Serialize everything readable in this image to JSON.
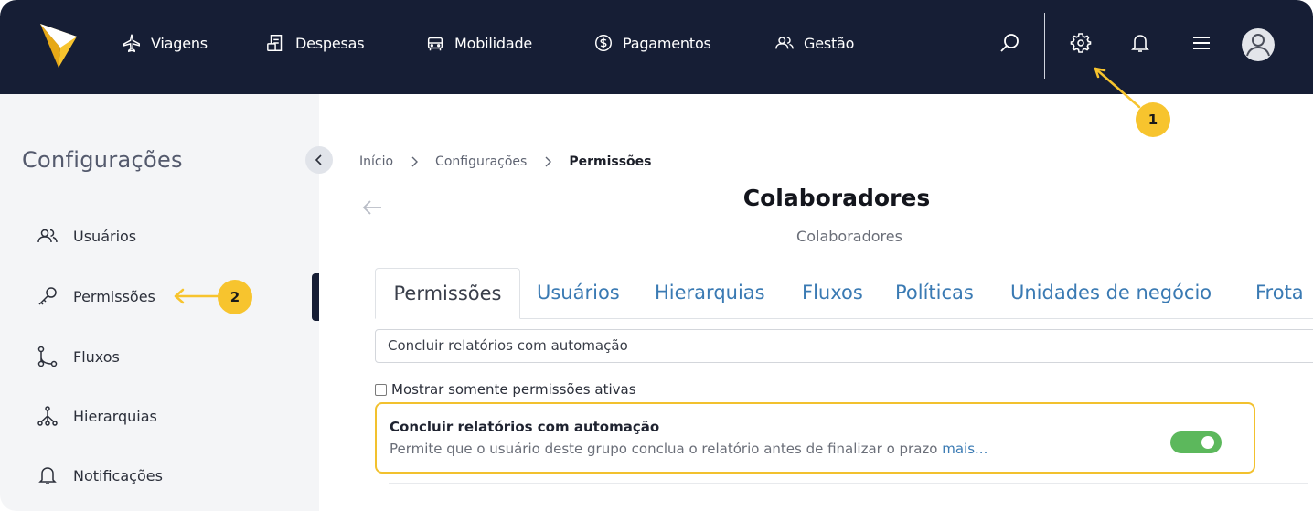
{
  "topnav": {
    "items": [
      {
        "label": "Viagens",
        "icon": "airplane-icon"
      },
      {
        "label": "Despesas",
        "icon": "receipt-icon"
      },
      {
        "label": "Mobilidade",
        "icon": "car-icon"
      },
      {
        "label": "Pagamentos",
        "icon": "dollar-coin-icon"
      },
      {
        "label": "Gestão",
        "icon": "users-icon"
      }
    ],
    "icons": [
      "search-icon",
      "gear-icon",
      "bell-icon",
      "menu-icon",
      "avatar-icon"
    ]
  },
  "sidebar": {
    "title": "Configurações",
    "items": [
      {
        "label": "Usuários",
        "icon": "users-icon"
      },
      {
        "label": "Permissões",
        "icon": "key-icon"
      },
      {
        "label": "Fluxos",
        "icon": "flow-icon"
      },
      {
        "label": "Hierarquias",
        "icon": "hierarchy-icon"
      },
      {
        "label": "Notificações",
        "icon": "bell-icon"
      }
    ],
    "active": "Permissões"
  },
  "breadcrumb": [
    "Início",
    "Configurações",
    "Permissões"
  ],
  "page": {
    "title": "Colaboradores",
    "subtitle": "Colaboradores"
  },
  "tabs": [
    "Permissões",
    "Usuários",
    "Hierarquias",
    "Fluxos",
    "Políticas",
    "Unidades de negócio",
    "Frota"
  ],
  "search": {
    "value": "Concluir relatórios com automação"
  },
  "filter": {
    "label": "Mostrar somente permissões ativas",
    "checked": false
  },
  "permission": {
    "title": "Concluir relatórios com automação",
    "description": "Permite que o usuário deste grupo conclua o relatório antes de finalizar o prazo",
    "more": "mais...",
    "enabled": true
  },
  "callouts": {
    "one": "1",
    "two": "2"
  },
  "colors": {
    "navbar": "#161e35",
    "accent": "#f7c42e",
    "link": "#3a7ab3",
    "toggle_on": "#5cb85c"
  }
}
